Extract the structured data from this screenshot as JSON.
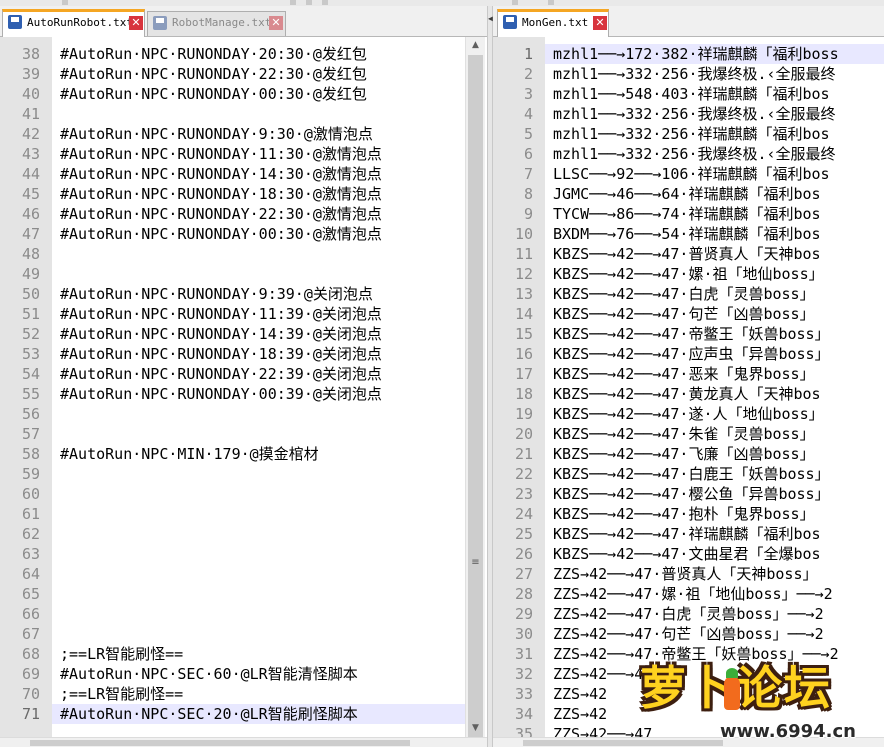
{
  "left_pane": {
    "tabs": [
      {
        "label": "AutoRunRobot.txt",
        "active": true
      },
      {
        "label": "RobotManage.txt",
        "active": false
      }
    ],
    "lines": [
      {
        "n": "38",
        "text": "#AutoRun·NPC·RUNONDAY·20:30·@发红包"
      },
      {
        "n": "39",
        "text": "#AutoRun·NPC·RUNONDAY·22:30·@发红包"
      },
      {
        "n": "40",
        "text": "#AutoRun·NPC·RUNONDAY·00:30·@发红包"
      },
      {
        "n": "41",
        "text": ""
      },
      {
        "n": "42",
        "text": "#AutoRun·NPC·RUNONDAY·9:30·@激情泡点"
      },
      {
        "n": "43",
        "text": "#AutoRun·NPC·RUNONDAY·11:30·@激情泡点"
      },
      {
        "n": "44",
        "text": "#AutoRun·NPC·RUNONDAY·14:30·@激情泡点"
      },
      {
        "n": "45",
        "text": "#AutoRun·NPC·RUNONDAY·18:30·@激情泡点"
      },
      {
        "n": "46",
        "text": "#AutoRun·NPC·RUNONDAY·22:30·@激情泡点"
      },
      {
        "n": "47",
        "text": "#AutoRun·NPC·RUNONDAY·00:30·@激情泡点"
      },
      {
        "n": "48",
        "text": ""
      },
      {
        "n": "49",
        "text": ""
      },
      {
        "n": "50",
        "text": "#AutoRun·NPC·RUNONDAY·9:39·@关闭泡点"
      },
      {
        "n": "51",
        "text": "#AutoRun·NPC·RUNONDAY·11:39·@关闭泡点"
      },
      {
        "n": "52",
        "text": "#AutoRun·NPC·RUNONDAY·14:39·@关闭泡点"
      },
      {
        "n": "53",
        "text": "#AutoRun·NPC·RUNONDAY·18:39·@关闭泡点"
      },
      {
        "n": "54",
        "text": "#AutoRun·NPC·RUNONDAY·22:39·@关闭泡点"
      },
      {
        "n": "55",
        "text": "#AutoRun·NPC·RUNONDAY·00:39·@关闭泡点"
      },
      {
        "n": "56",
        "text": ""
      },
      {
        "n": "57",
        "text": ""
      },
      {
        "n": "58",
        "text": "#AutoRun·NPC·MIN·179·@摸金棺材"
      },
      {
        "n": "59",
        "text": ""
      },
      {
        "n": "60",
        "text": ""
      },
      {
        "n": "61",
        "text": ""
      },
      {
        "n": "62",
        "text": ""
      },
      {
        "n": "63",
        "text": ""
      },
      {
        "n": "64",
        "text": ""
      },
      {
        "n": "65",
        "text": ""
      },
      {
        "n": "66",
        "text": ""
      },
      {
        "n": "67",
        "text": ""
      },
      {
        "n": "68",
        "text": ";==LR智能刷怪=="
      },
      {
        "n": "69",
        "text": "#AutoRun·NPC·SEC·60·@LR智能清怪脚本"
      },
      {
        "n": "70",
        "text": ";==LR智能刷怪=="
      },
      {
        "n": "71",
        "text": "#AutoRun·NPC·SEC·20·@LR智能刷怪脚本"
      }
    ],
    "highlighted_line": "71"
  },
  "right_pane": {
    "tabs": [
      {
        "label": "MonGen.txt",
        "active": true
      }
    ],
    "lines": [
      {
        "n": "1",
        "text": "mzhl1──→172·382·祥瑞麒麟「福利boss"
      },
      {
        "n": "2",
        "text": "mzhl1──→332·256·我爆终极.‹全服最终"
      },
      {
        "n": "3",
        "text": "mzhl1──→548·403·祥瑞麒麟「福利bos"
      },
      {
        "n": "4",
        "text": "mzhl1──→332·256·我爆终极.‹全服最终"
      },
      {
        "n": "5",
        "text": "mzhl1──→332·256·祥瑞麒麟「福利bos"
      },
      {
        "n": "6",
        "text": "mzhl1──→332·256·我爆终极.‹全服最终"
      },
      {
        "n": "7",
        "text": "LLSC──→92──→106·祥瑞麒麟「福利bos"
      },
      {
        "n": "8",
        "text": "JGMC──→46──→64·祥瑞麒麟「福利bos"
      },
      {
        "n": "9",
        "text": "TYCW──→86──→74·祥瑞麒麟「福利bos"
      },
      {
        "n": "10",
        "text": "BXDM──→76──→54·祥瑞麒麟「福利bos"
      },
      {
        "n": "11",
        "text": "KBZS──→42──→47·普贤真人「天神bos"
      },
      {
        "n": "12",
        "text": "KBZS──→42──→47·嫘·祖「地仙boss」"
      },
      {
        "n": "13",
        "text": "KBZS──→42──→47·白虎「灵兽boss」"
      },
      {
        "n": "14",
        "text": "KBZS──→42──→47·句芒「凶兽boss」"
      },
      {
        "n": "15",
        "text": "KBZS──→42──→47·帝鳖王「妖兽boss」"
      },
      {
        "n": "16",
        "text": "KBZS──→42──→47·应声虫「异兽boss」"
      },
      {
        "n": "17",
        "text": "KBZS──→42──→47·恶来「鬼界boss」"
      },
      {
        "n": "18",
        "text": "KBZS──→42──→47·黄龙真人「天神bos"
      },
      {
        "n": "19",
        "text": "KBZS──→42──→47·遂·人「地仙boss」"
      },
      {
        "n": "20",
        "text": "KBZS──→42──→47·朱雀「灵兽boss」"
      },
      {
        "n": "21",
        "text": "KBZS──→42──→47·飞廉「凶兽boss」"
      },
      {
        "n": "22",
        "text": "KBZS──→42──→47·白鹿王「妖兽boss」"
      },
      {
        "n": "23",
        "text": "KBZS──→42──→47·樱公鱼「异兽boss」"
      },
      {
        "n": "24",
        "text": "KBZS──→42──→47·抱朴「鬼界boss」"
      },
      {
        "n": "25",
        "text": "KBZS──→42──→47·祥瑞麒麟「福利bos"
      },
      {
        "n": "26",
        "text": "KBZS──→42──→47·文曲星君「全爆bos"
      },
      {
        "n": "27",
        "text": "ZZS→42──→47·普贤真人「天神boss」"
      },
      {
        "n": "28",
        "text": "ZZS→42──→47·嫘·祖「地仙boss」──→2"
      },
      {
        "n": "29",
        "text": "ZZS→42──→47·白虎「灵兽boss」──→2"
      },
      {
        "n": "30",
        "text": "ZZS→42──→47·句芒「凶兽boss」──→2"
      },
      {
        "n": "31",
        "text": "ZZS→42──→47·帝鳖王「妖兽boss」──→2"
      },
      {
        "n": "32",
        "text": "ZZS→42──→47·"
      },
      {
        "n": "33",
        "text": "ZZS→42"
      },
      {
        "n": "34",
        "text": "ZZS→42"
      },
      {
        "n": "35",
        "text": "ZZS→42──→47"
      }
    ],
    "highlighted_line": "1"
  },
  "watermark": {
    "text": "萝卜论坛",
    "url": "www.6994.cn"
  },
  "colors": {
    "active_tab_accent": "#f5a623",
    "close_button": "#d8343d",
    "current_line": "#e8e8ff",
    "gutter": "#e4e4e4",
    "line_number": "#8b8b8b"
  }
}
